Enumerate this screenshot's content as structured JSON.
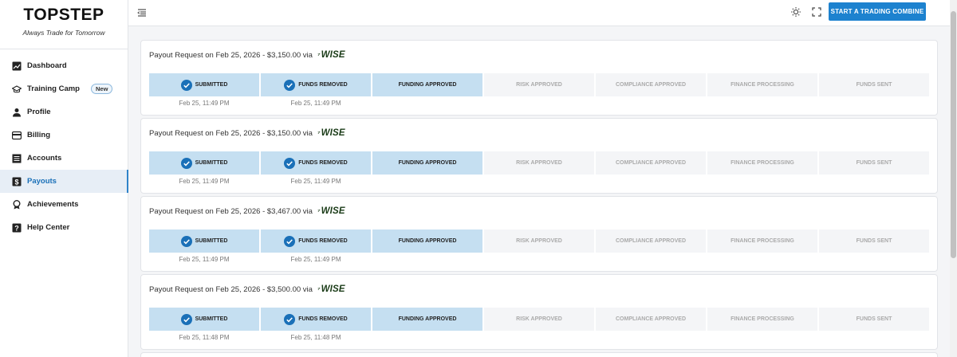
{
  "brand": {
    "logo": "TOPSTEP",
    "tagline": "Always Trade for Tomorrow"
  },
  "sidebar": {
    "items": [
      {
        "label": "Dashboard",
        "icon": "dashboard-chart-icon",
        "active": false
      },
      {
        "label": "Training Camp",
        "icon": "graduation-cap-icon",
        "active": false,
        "badge": "New"
      },
      {
        "label": "Profile",
        "icon": "person-icon",
        "active": false
      },
      {
        "label": "Billing",
        "icon": "billing-icon",
        "active": false
      },
      {
        "label": "Accounts",
        "icon": "list-icon",
        "active": false
      },
      {
        "label": "Payouts",
        "icon": "dollar-icon",
        "active": true
      },
      {
        "label": "Achievements",
        "icon": "award-icon",
        "active": false
      },
      {
        "label": "Help Center",
        "icon": "help-icon",
        "active": false
      }
    ]
  },
  "topbar": {
    "cta_label": "START A TRADING COMBINE"
  },
  "colors": {
    "accent": "#1d82cf",
    "step_done": "#c5dff1",
    "step_pending": "#f4f5f7",
    "check": "#1a70b8"
  },
  "payment_method": {
    "flag": "⁷",
    "name": "WISE"
  },
  "payouts": [
    {
      "title": "Payout Request on Feb 25, 2026 - $3,150.00 via",
      "steps": [
        {
          "label": "SUBMITTED",
          "done": true,
          "checked": true,
          "date": "Feb 25, 11:49 PM"
        },
        {
          "label": "FUNDS REMOVED",
          "done": true,
          "checked": true,
          "date": "Feb 25, 11:49 PM"
        },
        {
          "label": "FUNDING APPROVED",
          "done": true,
          "checked": false,
          "date": ""
        },
        {
          "label": "RISK APPROVED",
          "done": false,
          "checked": false,
          "date": ""
        },
        {
          "label": "COMPLIANCE APPROVED",
          "done": false,
          "checked": false,
          "date": ""
        },
        {
          "label": "FINANCE PROCESSING",
          "done": false,
          "checked": false,
          "date": ""
        },
        {
          "label": "FUNDS SENT",
          "done": false,
          "checked": false,
          "date": ""
        }
      ]
    },
    {
      "title": "Payout Request on Feb 25, 2026 - $3,150.00 via",
      "steps": [
        {
          "label": "SUBMITTED",
          "done": true,
          "checked": true,
          "date": "Feb 25, 11:49 PM"
        },
        {
          "label": "FUNDS REMOVED",
          "done": true,
          "checked": true,
          "date": "Feb 25, 11:49 PM"
        },
        {
          "label": "FUNDING APPROVED",
          "done": true,
          "checked": false,
          "date": ""
        },
        {
          "label": "RISK APPROVED",
          "done": false,
          "checked": false,
          "date": ""
        },
        {
          "label": "COMPLIANCE APPROVED",
          "done": false,
          "checked": false,
          "date": ""
        },
        {
          "label": "FINANCE PROCESSING",
          "done": false,
          "checked": false,
          "date": ""
        },
        {
          "label": "FUNDS SENT",
          "done": false,
          "checked": false,
          "date": ""
        }
      ]
    },
    {
      "title": "Payout Request on Feb 25, 2026 - $3,467.00 via",
      "steps": [
        {
          "label": "SUBMITTED",
          "done": true,
          "checked": true,
          "date": "Feb 25, 11:49 PM"
        },
        {
          "label": "FUNDS REMOVED",
          "done": true,
          "checked": true,
          "date": "Feb 25, 11:49 PM"
        },
        {
          "label": "FUNDING APPROVED",
          "done": true,
          "checked": false,
          "date": ""
        },
        {
          "label": "RISK APPROVED",
          "done": false,
          "checked": false,
          "date": ""
        },
        {
          "label": "COMPLIANCE APPROVED",
          "done": false,
          "checked": false,
          "date": ""
        },
        {
          "label": "FINANCE PROCESSING",
          "done": false,
          "checked": false,
          "date": ""
        },
        {
          "label": "FUNDS SENT",
          "done": false,
          "checked": false,
          "date": ""
        }
      ]
    },
    {
      "title": "Payout Request on Feb 25, 2026 - $3,500.00 via",
      "steps": [
        {
          "label": "SUBMITTED",
          "done": true,
          "checked": true,
          "date": "Feb 25, 11:48 PM"
        },
        {
          "label": "FUNDS REMOVED",
          "done": true,
          "checked": true,
          "date": "Feb 25, 11:48 PM"
        },
        {
          "label": "FUNDING APPROVED",
          "done": true,
          "checked": false,
          "date": ""
        },
        {
          "label": "RISK APPROVED",
          "done": false,
          "checked": false,
          "date": ""
        },
        {
          "label": "COMPLIANCE APPROVED",
          "done": false,
          "checked": false,
          "date": ""
        },
        {
          "label": "FINANCE PROCESSING",
          "done": false,
          "checked": false,
          "date": ""
        },
        {
          "label": "FUNDS SENT",
          "done": false,
          "checked": false,
          "date": ""
        }
      ]
    }
  ]
}
